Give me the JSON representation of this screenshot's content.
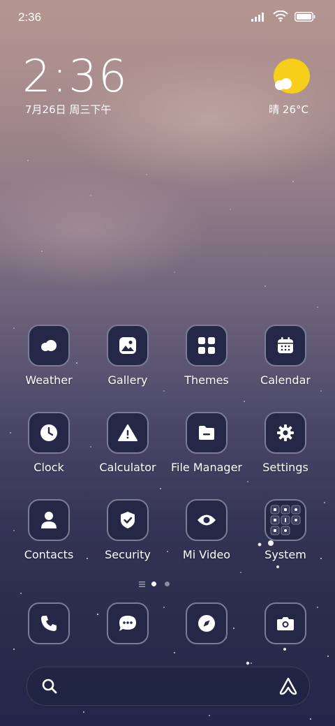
{
  "status_bar": {
    "time": "2:36"
  },
  "lock_widget": {
    "clock": "2:36",
    "date": "7月26日 周三下午"
  },
  "weather_widget": {
    "condition_temp": "晴 26°C"
  },
  "apps": [
    {
      "label": "Weather",
      "icon": "weather-icon"
    },
    {
      "label": "Gallery",
      "icon": "gallery-icon"
    },
    {
      "label": "Themes",
      "icon": "themes-icon"
    },
    {
      "label": "Calendar",
      "icon": "calendar-icon"
    },
    {
      "label": "Clock",
      "icon": "clock-icon"
    },
    {
      "label": "Calculator",
      "icon": "calculator-icon"
    },
    {
      "label": "File Manager",
      "icon": "file-manager-icon"
    },
    {
      "label": "Settings",
      "icon": "settings-icon"
    },
    {
      "label": "Contacts",
      "icon": "contacts-icon"
    },
    {
      "label": "Security",
      "icon": "security-icon"
    },
    {
      "label": "Mi Video",
      "icon": "mi-video-icon"
    },
    {
      "label": "System",
      "icon": "system-folder-icon"
    }
  ],
  "dock": [
    {
      "icon": "phone-icon"
    },
    {
      "icon": "messages-icon"
    },
    {
      "icon": "browser-compass-icon"
    },
    {
      "icon": "camera-icon"
    }
  ],
  "search": {
    "icons": [
      "search-icon",
      "assistant-icon"
    ]
  },
  "colors": {
    "icon_bg": "#252747",
    "icon_border": "#7a7d95",
    "sun": "#f7cf1a"
  }
}
